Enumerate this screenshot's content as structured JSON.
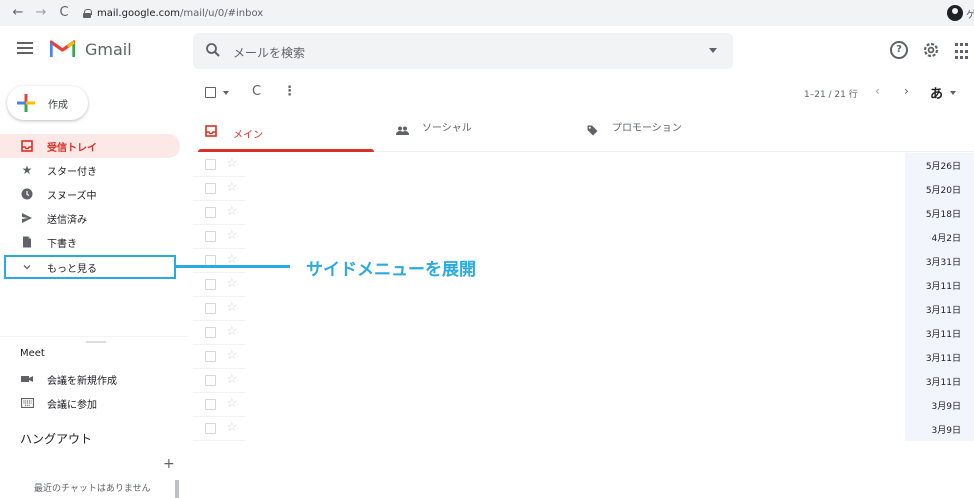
{
  "browser": {
    "url_domain": "mail.google.com",
    "url_path": "/mail/u/0/#inbox",
    "back": "←",
    "forward": "→",
    "reload": "C",
    "profile_more": "ゲ"
  },
  "header": {
    "app_name": "Gmail",
    "search_placeholder": "メールを検索",
    "help": "?"
  },
  "sidebar": {
    "compose_label": "作成",
    "items": [
      {
        "label": "受信トレイ",
        "icon": "inbox-icon",
        "active": true
      },
      {
        "label": "スター付き",
        "icon": "star-icon"
      },
      {
        "label": "スヌーズ中",
        "icon": "clock-icon"
      },
      {
        "label": "送信済み",
        "icon": "send-icon"
      },
      {
        "label": "下書き",
        "icon": "draft-icon"
      },
      {
        "label": "もっと見る",
        "icon": "chevron-down-icon"
      }
    ],
    "meet_title": "Meet",
    "meet_items": [
      {
        "label": "会議を新規作成",
        "icon": "video-icon"
      },
      {
        "label": "会議に参加",
        "icon": "keyboard-icon"
      }
    ],
    "hangout_title": "ハングアウト",
    "hangout_add": "+",
    "no_chat": "最近のチャットはありません"
  },
  "toolbar": {
    "refresh": "C",
    "more": "⋮",
    "pager_text": "1–21 / 21 行",
    "prev": "‹",
    "next": "›",
    "ime": "あ"
  },
  "tabs": [
    {
      "label": "メイン",
      "active": true
    },
    {
      "label": "ソーシャル"
    },
    {
      "label": "プロモーション"
    }
  ],
  "emails": [
    {
      "date": "5月26日"
    },
    {
      "date": "5月20日"
    },
    {
      "date": "5月18日"
    },
    {
      "date": "4月2日"
    },
    {
      "date": "3月31日"
    },
    {
      "date": "3月11日"
    },
    {
      "date": "3月11日"
    },
    {
      "date": "3月11日"
    },
    {
      "date": "3月11日"
    },
    {
      "date": "3月11日"
    },
    {
      "date": "3月9日"
    },
    {
      "date": "3月9日"
    }
  ],
  "annotation": {
    "text": "サイドメニューを展開",
    "color": "#29abe2"
  },
  "colors": {
    "accent_red": "#d93025",
    "active_bg": "#fce8e6",
    "annotation_blue": "#29abe2"
  }
}
